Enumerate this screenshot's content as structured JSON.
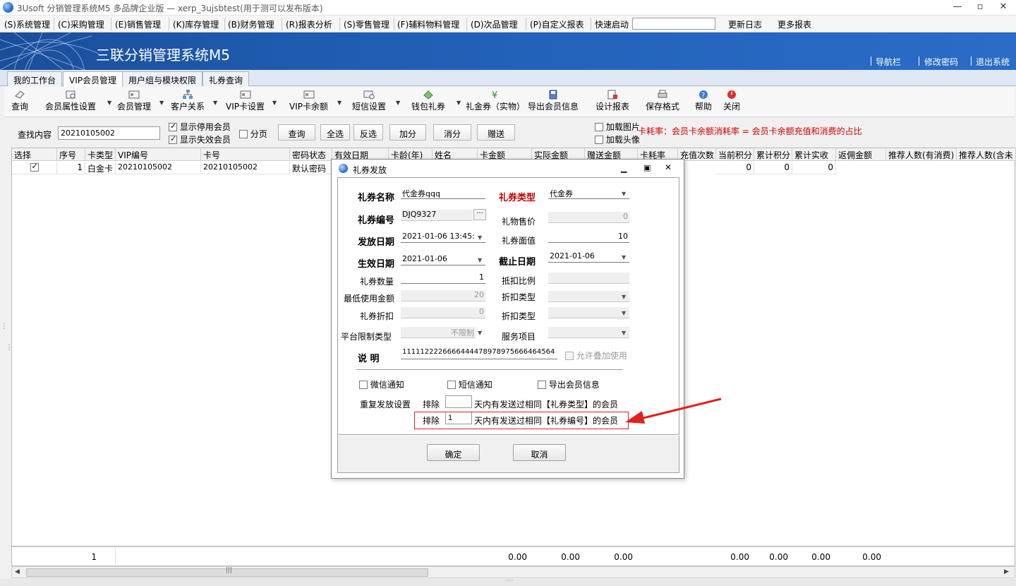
{
  "window": {
    "title": "3Usoft 分销管理系统M5 多品牌企业版 — xerp_3ujsbtest(用于测可以发布版本)",
    "min": "—",
    "max": "▫",
    "close": "✕"
  },
  "menu": {
    "items": [
      "(S)系统管理",
      "(C)采购管理",
      "(E)销售管理",
      "(K)库存管理",
      "(B)财务管理",
      "(R)报表分析",
      "(S)零售管理",
      "(F)辅料物料管理",
      "(D)次品管理",
      "(P)自定义报表"
    ],
    "quickstart": "快速启动",
    "quickstart_value": "",
    "changelog": "更新日志",
    "more_reports": "更多报表"
  },
  "banner": {
    "brand": "三联分销管理系统M5",
    "nav": "导航栏",
    "change_pwd": "修改密码",
    "logout": "退出系统"
  },
  "tabs": [
    "我的工作台",
    "VIP会员管理",
    "用户组与模块权限",
    "礼券查询"
  ],
  "toolbar": {
    "query": "查询",
    "member_attr": "会员属性设置",
    "member_mgmt": "会员管理",
    "customer_rel": "客户关系",
    "vip_card": "VIP卡设置",
    "vip_balance": "VIP卡余额",
    "sms": "短信设置",
    "wallet_gift": "钱包礼券",
    "gift_coupon": "礼金券（实物）",
    "export_member": "导出会员信息",
    "design_report": "设计报表",
    "save_format": "保存格式",
    "help": "帮助",
    "close": "关闭"
  },
  "filter": {
    "search_label": "查找内容",
    "search_value": "20210105002",
    "show_disabled": "显示停用会员",
    "show_invalid": "显示失效会员",
    "paging": "分页",
    "btn_query": "查询",
    "btn_select_all": "全选",
    "btn_invert": "反选",
    "btn_add_points": "加分",
    "btn_sub_points": "消分",
    "btn_gift": "赠送",
    "load_image": "加载图片",
    "load_avatar": "加载头像",
    "consume_note": "卡耗率：会员卡余额消耗率 =  会员卡余额充值和消费的占比"
  },
  "grid": {
    "headers": [
      "选择",
      "序号",
      "卡类型",
      "VIP编号",
      "卡号",
      "密码状态",
      "有效日期",
      "卡龄(年)",
      "姓名",
      "卡金额",
      "实际金额",
      "赠送金额",
      "卡耗率",
      "充值次数",
      "当前积分",
      "累计积分",
      "累计实收",
      "返佣金额",
      "推荐人数(有消费)",
      "推荐人数(含未"
    ],
    "row": {
      "seq": "1",
      "card_type": "白金卡",
      "vip_no": "20210105002",
      "card_no": "20210105002",
      "pwd_status": "默认密码",
      "cur_points": "0",
      "acc_points": "0",
      "acc_received": "0"
    },
    "footer": {
      "count": "1",
      "card_amount": "0.00",
      "actual_amount": "0.00",
      "gift_amount": "0.00",
      "cur_points": "0.00",
      "acc_points": "0.00",
      "acc_received": "0.00",
      "rebate": "0.00"
    }
  },
  "dialog": {
    "title": "礼券发放",
    "coupon_name_label": "礼券名称",
    "coupon_name": "代金券qqq",
    "coupon_type_label": "礼券类型",
    "coupon_type": "代金券",
    "coupon_no_label": "礼券编号",
    "coupon_no": "DJQ9327",
    "browse": "···",
    "gift_price_label": "礼物售价",
    "gift_price": "0",
    "issue_date_label": "发放日期",
    "issue_date": "2021-01-06 13:45:",
    "face_value_label": "礼券面值",
    "face_value": "10",
    "effective_date_label": "生效日期",
    "effective_date": "2021-01-06",
    "expiry_date_label": "截止日期",
    "expiry_date": "2021-01-06",
    "qty_label": "礼券数量",
    "qty": "1",
    "deduct_ratio_label": "抵扣比例",
    "deduct_ratio": "",
    "min_amount_label": "最低使用金额",
    "min_amount": "20",
    "discount_type_label": "折扣类型",
    "discount_type": "",
    "coupon_discount_label": "礼券折扣",
    "coupon_discount": "0",
    "discount_type2_label": "折扣类型",
    "discount_type2": "",
    "platform_label": "平台限制类型",
    "platform": "不限制",
    "service_label": "服务项目",
    "service": "",
    "desc_label": "说    明",
    "desc": "11111222266664444789789756664645​64",
    "allow_stack": "允许叠加使用",
    "wechat_notify": "微信通知",
    "sms_notify": "短信通知",
    "export_info": "导出会员信息",
    "repeat_label": "重复发放设置",
    "exclude1_prefix": "排除",
    "exclude1_value": "",
    "exclude1_suffix": "天内有发送过相同【礼券类型】的会员",
    "exclude2_prefix": "排除",
    "exclude2_value": "1",
    "exclude2_suffix": "天内有发送过相同【礼券编号】的会员",
    "ok": "确定",
    "cancel": "取消"
  },
  "colors": {
    "banner": "#1f5cb0",
    "accent_red": "#c00000",
    "annotation_red": "#e02020"
  }
}
